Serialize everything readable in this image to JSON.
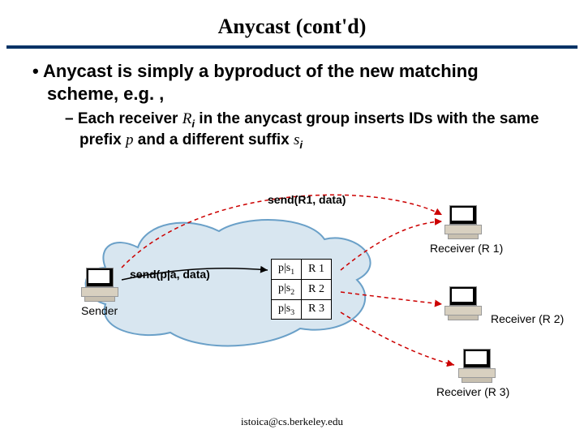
{
  "title": "Anycast (cont'd)",
  "bullet1_html": "• Anycast is simply a byproduct of the new matching scheme, e.g. ,",
  "bullet2_prefix": "– Each receiver ",
  "bullet2_r": "R",
  "bullet2_ri": "i",
  "bullet2_mid": " in the anycast group inserts IDs with the same prefix ",
  "bullet2_p": "p",
  "bullet2_mid2": " and a different suffix ",
  "bullet2_s": "s",
  "bullet2_si": "i",
  "send_top": "send(R1, data)",
  "send_left": "send(p|a, data)",
  "sender": "Sender",
  "recv1": "Receiver (R 1)",
  "recv2": "Receiver (R 2)",
  "recv3": "Receiver (R 3)",
  "table": {
    "r1c1": "p|s",
    "r1s": "1",
    "r1c2": "R 1",
    "r2c1": "p|s",
    "r2s": "2",
    "r2c2": "R 2",
    "r3c1": "p|s",
    "r3s": "3",
    "r3c2": "R 3"
  },
  "footer": "istoica@cs.berkeley.edu"
}
